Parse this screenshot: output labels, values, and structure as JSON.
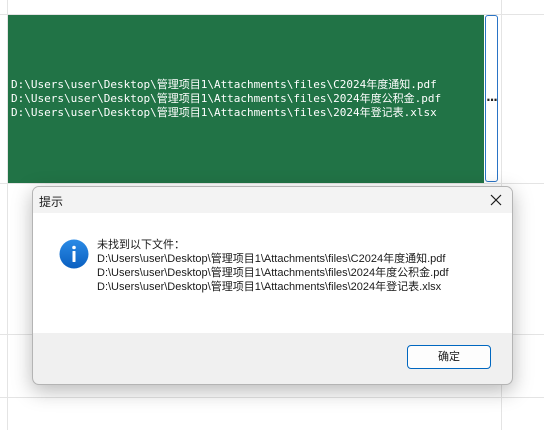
{
  "sheet": {
    "lines": [
      "D:\\Users\\user\\Desktop\\管理项目1\\Attachments\\files\\C2024年度通知.pdf",
      "D:\\Users\\user\\Desktop\\管理项目1\\Attachments\\files\\2024年度公积金.pdf",
      "D:\\Users\\user\\Desktop\\管理项目1\\Attachments\\files\\2024年登记表.xlsx"
    ],
    "panel_color": "#217346",
    "more_button_label": "..."
  },
  "dialog": {
    "title": "提示",
    "icon": "info-icon",
    "heading": "未找到以下文件：",
    "files": [
      "D:\\Users\\user\\Desktop\\管理项目1\\Attachments\\files\\C2024年度通知.pdf",
      "D:\\Users\\user\\Desktop\\管理项目1\\Attachments\\files\\2024年度公积金.pdf",
      "D:\\Users\\user\\Desktop\\管理项目1\\Attachments\\files\\2024年登记表.xlsx"
    ],
    "ok_label": "确定",
    "accent_color": "#0067c0"
  }
}
